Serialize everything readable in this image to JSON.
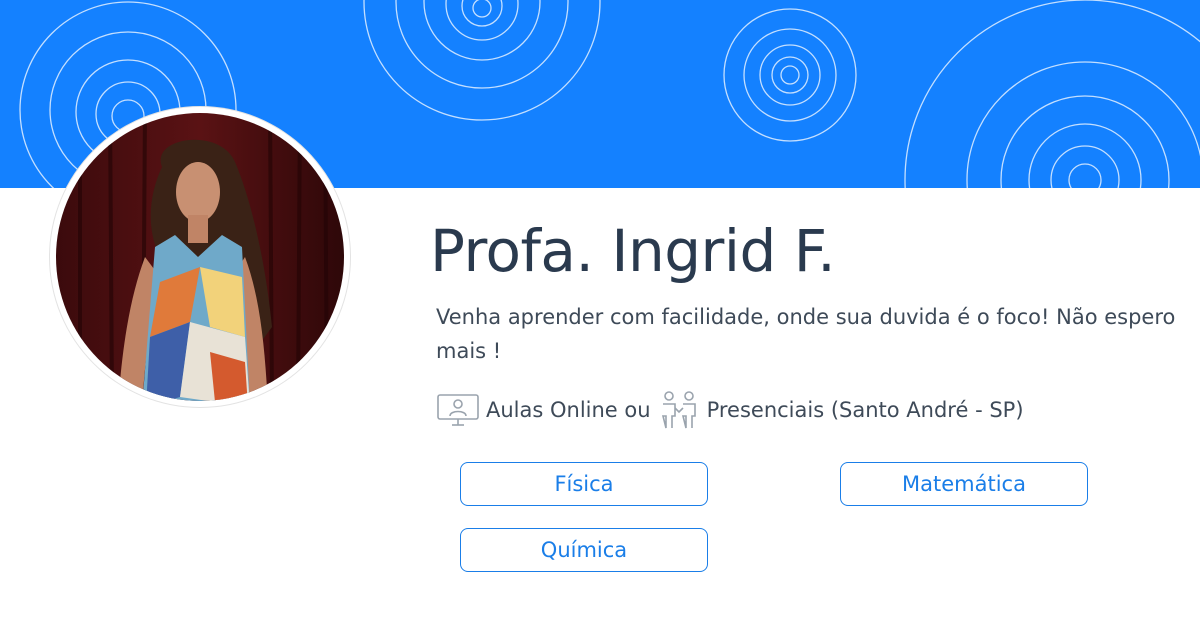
{
  "profile": {
    "name": "Profa. Ingrid F.",
    "tagline": "Venha aprender com facilidade, onde sua duvida é o foco! Não espero mais !",
    "modes": {
      "online_icon": "monitor-user-icon",
      "online_text": "Aulas Online ou",
      "presential_icon": "people-meeting-icon",
      "presential_text": "Presenciais (Santo André - SP)"
    }
  },
  "subjects": [
    "Física",
    "Matemática",
    "Química"
  ],
  "colors": {
    "banner": "#1481ff",
    "accent": "#1a7ee8",
    "name_text": "#2a3a4e",
    "body_text": "#3e4a58"
  }
}
